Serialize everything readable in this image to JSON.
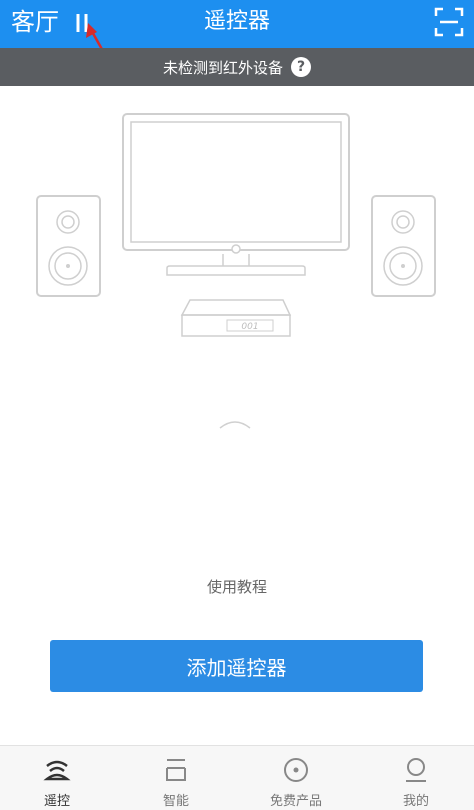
{
  "header": {
    "room": "客厅",
    "title": "遥控器",
    "scan_icon": "scan-icon",
    "room_arrow_icon": "chevron-down-icon"
  },
  "notice": {
    "text": "未检测到红外设备",
    "help": "?"
  },
  "main": {
    "device_label": "001",
    "tutorial": "使用教程",
    "add_button": "添加遥控器"
  },
  "tabs": [
    {
      "label": "遥控",
      "icon": "remote-icon",
      "active": true
    },
    {
      "label": "智能",
      "icon": "smart-icon",
      "active": false
    },
    {
      "label": "免费产品",
      "icon": "free-product-icon",
      "active": false
    },
    {
      "label": "我的",
      "icon": "profile-icon",
      "active": false
    }
  ],
  "colors": {
    "header": "#1d8ff0",
    "notice_bar": "#5a5d61",
    "button": "#2c8ce4",
    "annotation_arrow": "#d62b2b"
  }
}
